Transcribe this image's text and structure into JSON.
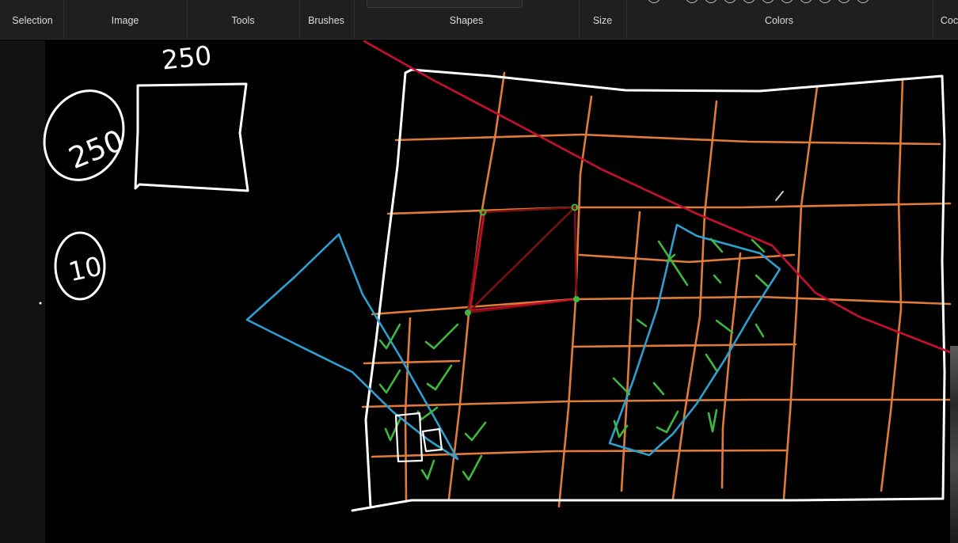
{
  "ribbon": {
    "groups": [
      {
        "label": "Selection"
      },
      {
        "label": "Image"
      },
      {
        "label": "Tools"
      },
      {
        "label": "Brushes"
      },
      {
        "label": "Shapes"
      },
      {
        "label": "Size"
      },
      {
        "label": "Colors"
      },
      {
        "label": "Coc"
      }
    ]
  },
  "canvas": {
    "annotations": {
      "top_number": "250",
      "circled_number_1": "250",
      "circled_number_2": "10"
    },
    "colors": {
      "background": "#000000",
      "white_stroke": "#ffffff",
      "grid_stroke": "#e07b39",
      "red_stroke": "#c8102e",
      "dark_red_stroke": "#7a1010",
      "blue_stroke": "#2d9fd0",
      "green_stroke": "#3dba3d"
    }
  }
}
